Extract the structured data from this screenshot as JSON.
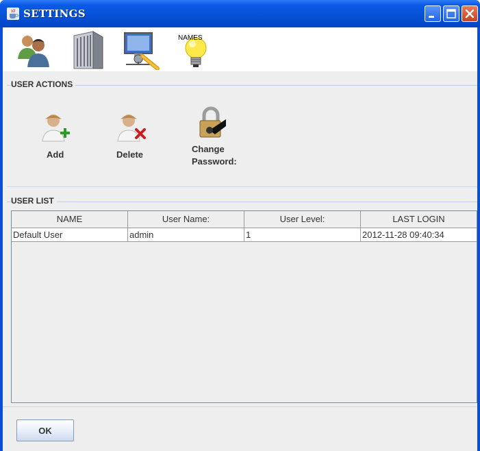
{
  "window": {
    "title": "SETTINGS",
    "title_icon": "java-cup-icon"
  },
  "toolbar": {
    "items": [
      {
        "name": "users",
        "icon": "users-icon"
      },
      {
        "name": "building",
        "icon": "building-icon"
      },
      {
        "name": "network",
        "icon": "network-computer-icon"
      },
      {
        "name": "names",
        "icon": "lightbulb-icon",
        "label": "NAMES"
      }
    ]
  },
  "user_actions": {
    "title": "USER ACTIONS",
    "add_label": "Add",
    "delete_label": "Delete",
    "change_password_label_line1": "Change",
    "change_password_label_line2": "Password:"
  },
  "user_list": {
    "title": "USER LIST",
    "columns": [
      "NAME",
      "User Name:",
      "User Level:",
      "LAST LOGIN"
    ],
    "rows": [
      [
        "Default User",
        "admin",
        "1",
        "2012-11-28 09:40:34"
      ]
    ]
  },
  "buttons": {
    "ok_label": "OK"
  },
  "colors": {
    "titlebar": "#0550d6",
    "client_bg": "#eeeeee",
    "group_border": "#b8cfe5"
  }
}
